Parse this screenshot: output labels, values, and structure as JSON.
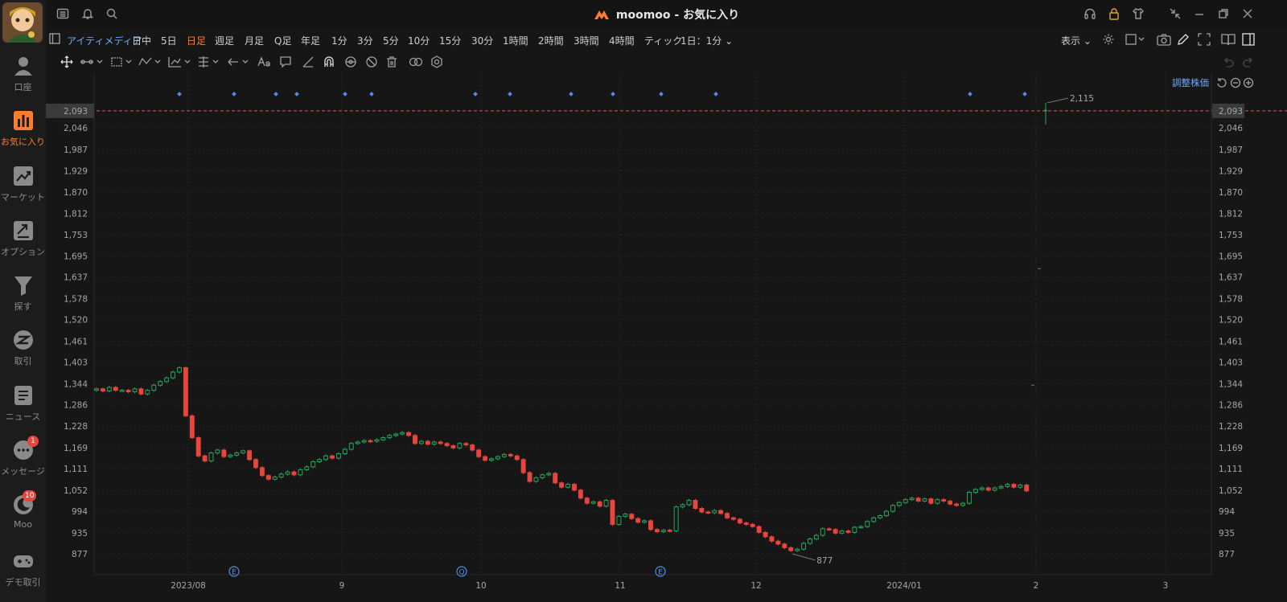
{
  "title": {
    "app_name": "moomoo - お気に入り"
  },
  "sidebar": {
    "items": [
      {
        "key": "account",
        "label": "口座",
        "icon": "person-icon"
      },
      {
        "key": "watchlist",
        "label": "お気に入り",
        "icon": "bar-chart-icon",
        "active": true
      },
      {
        "key": "market",
        "label": "マーケット",
        "icon": "trend-icon"
      },
      {
        "key": "options",
        "label": "オプション",
        "icon": "options-icon"
      },
      {
        "key": "screener",
        "label": "探す",
        "icon": "funnel-icon"
      },
      {
        "key": "trade",
        "label": "取引",
        "icon": "trade-icon"
      },
      {
        "key": "news",
        "label": "ニュース",
        "icon": "news-icon"
      },
      {
        "key": "messages",
        "label": "メッセージ",
        "icon": "chat-icon",
        "badge": "1"
      },
      {
        "key": "moo",
        "label": "Moo",
        "icon": "moon-icon",
        "badge": "10"
      },
      {
        "key": "demo",
        "label": "デモ取引",
        "icon": "gamepad-icon"
      }
    ]
  },
  "toolbar": {
    "company": "アイティメディア",
    "periods": [
      "日中",
      "5日",
      "日足",
      "週足",
      "月足",
      "Q足",
      "年足",
      "1分",
      "3分",
      "5分",
      "10分",
      "15分",
      "30分",
      "1時間",
      "2時間",
      "3時間",
      "4時間",
      "ティック"
    ],
    "active_period": "日足",
    "interval_select": "1日：1分",
    "display_label": "表示"
  },
  "chart": {
    "adjust_label": "調整株価",
    "current_price_label": "2,093",
    "high_annotation": "2,115",
    "low_annotation": "877",
    "event_markers": [
      "E",
      "Q",
      "E"
    ]
  },
  "chart_data": {
    "type": "candlestick",
    "y_ticks": [
      "2,046",
      "1,987",
      "1,929",
      "1,870",
      "1,812",
      "1,753",
      "1,695",
      "1,637",
      "1,578",
      "1,520",
      "1,461",
      "1,403",
      "1,344",
      "1,286",
      "1,228",
      "1,169",
      "1,111",
      "1,052",
      "994",
      "935",
      "877"
    ],
    "x_ticks": [
      "2023/08",
      "9",
      "10",
      "11",
      "12",
      "2024/01",
      "2",
      "3"
    ],
    "ylim": [
      820,
      2170
    ],
    "current_price": 2093,
    "period_high": 2115,
    "period_low": 877,
    "colors": {
      "up": "#26a65b",
      "down": "#e8453c",
      "accent": "#ff7d2c",
      "price_line": "#e0622a"
    },
    "closes": [
      1330,
      1324,
      1334,
      1326,
      1326,
      1322,
      1330,
      1316,
      1326,
      1340,
      1350,
      1360,
      1376,
      1388,
      1256,
      1196,
      1146,
      1132,
      1154,
      1162,
      1144,
      1148,
      1154,
      1160,
      1136,
      1114,
      1092,
      1082,
      1088,
      1096,
      1102,
      1094,
      1108,
      1116,
      1130,
      1136,
      1146,
      1140,
      1152,
      1164,
      1180,
      1184,
      1188,
      1186,
      1190,
      1196,
      1202,
      1206,
      1210,
      1202,
      1180,
      1186,
      1178,
      1184,
      1180,
      1174,
      1168,
      1180,
      1176,
      1162,
      1144,
      1134,
      1138,
      1144,
      1150,
      1146,
      1136,
      1100,
      1076,
      1086,
      1094,
      1098,
      1072,
      1060,
      1068,
      1052,
      1030,
      1016,
      1020,
      1008,
      1024,
      958,
      980,
      986,
      974,
      964,
      968,
      944,
      938,
      942,
      940,
      1006,
      1012,
      1024,
      1002,
      992,
      990,
      996,
      988,
      976,
      972,
      962,
      958,
      952,
      936,
      924,
      912,
      904,
      894,
      886,
      890,
      906,
      918,
      928,
      946,
      944,
      934,
      940,
      936,
      950,
      952,
      966,
      976,
      982,
      994,
      1010,
      1018,
      1026,
      1030,
      1022,
      1028,
      1016,
      1026,
      1022,
      1014,
      1010,
      1016,
      1046,
      1054,
      1058,
      1052,
      1058,
      1062,
      1068,
      1060,
      1066,
      1050,
      1340,
      1660,
      2093
    ]
  }
}
